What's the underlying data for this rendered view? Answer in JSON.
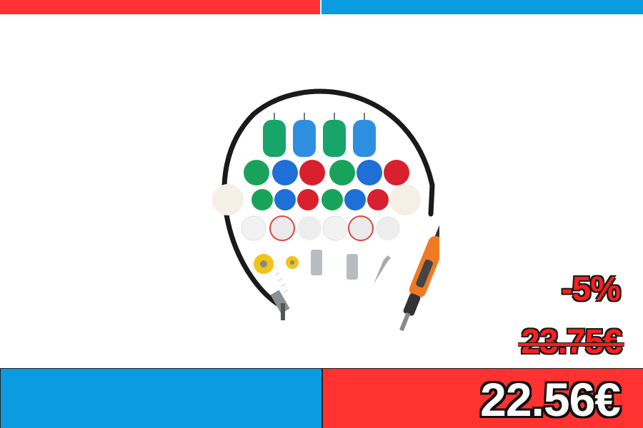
{
  "colors": {
    "red": "#ff3131",
    "blue": "#0b9be0"
  },
  "product": {
    "image_icon": "polishing-kit-image"
  },
  "pricing": {
    "discount": "-5%",
    "old_price": "23.75€",
    "new_price": "22.56€"
  }
}
